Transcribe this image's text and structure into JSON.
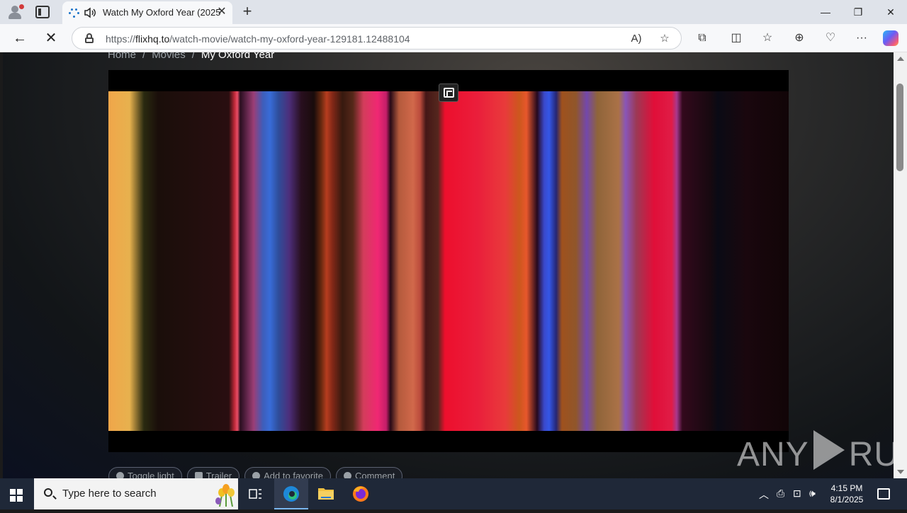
{
  "browser": {
    "tab_title": "Watch My Oxford Year (2025",
    "url_prefix": "https://",
    "url_host": "flixhq.to",
    "url_path": "/watch-movie/watch-my-oxford-year-129181.12488104",
    "icons": [
      "profile-icon",
      "tab-actions-icon",
      "audio-icon",
      "close-tab-icon",
      "new-tab-icon",
      "back-icon",
      "stop-loading-icon",
      "lock-icon",
      "read-aloud-icon",
      "favorite-star-icon",
      "extensions-icon",
      "split-screen-icon",
      "favorites-icon",
      "collections-icon",
      "browser-essentials-icon",
      "more-icon",
      "copilot-icon"
    ]
  },
  "page": {
    "breadcrumb": {
      "home": "Home",
      "sep": "/",
      "movies": "Movies",
      "current": "My Oxford Year"
    },
    "player_buttons": {
      "toggle_light": "Toggle light",
      "trailer": "Trailer",
      "add_favorite": "Add to favorite",
      "comment": "Comment"
    },
    "watermark": {
      "left": "ANY",
      "right": "RUN"
    }
  },
  "taskbar": {
    "search_placeholder": "Type here to search",
    "time": "4:15 PM",
    "date": "8/1/2025"
  }
}
